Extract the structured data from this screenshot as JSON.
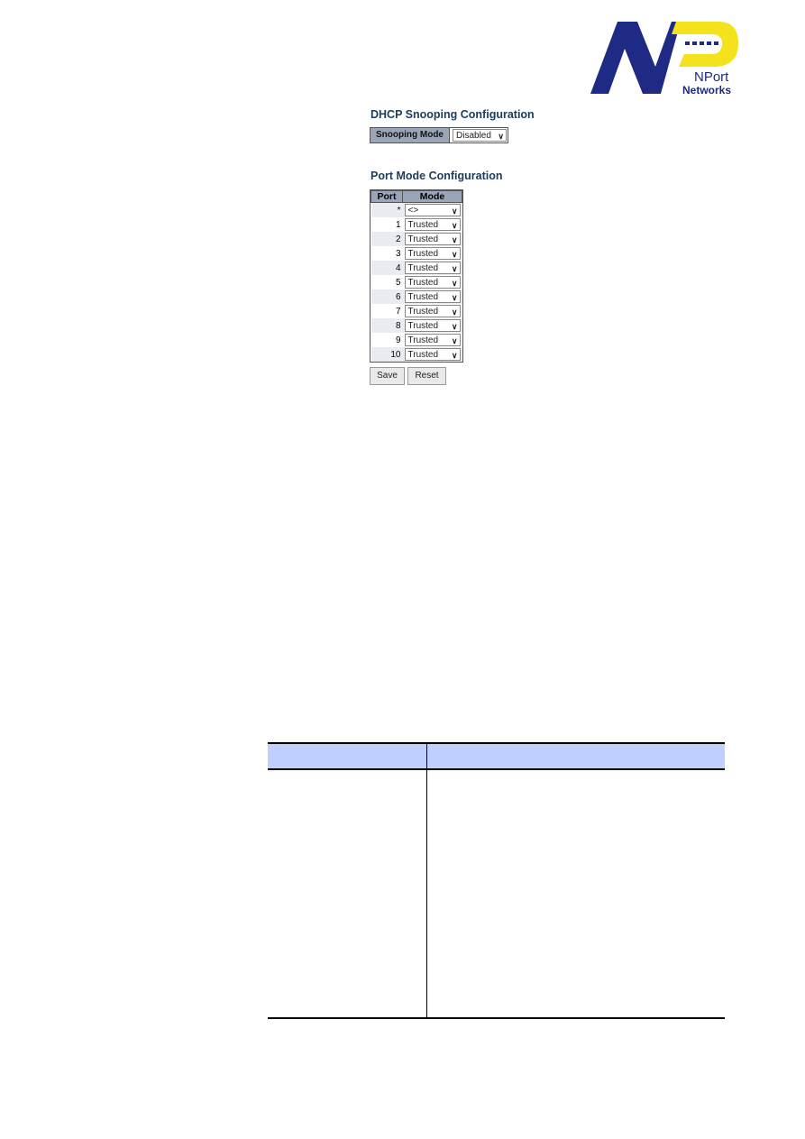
{
  "logo": {
    "brand_line1": "NPort",
    "brand_line2": "Networks",
    "colors": {
      "navy": "#1f2a85",
      "yellow": "#f4e21c"
    }
  },
  "dhcp": {
    "title": "DHCP Snooping Configuration",
    "mode_label": "Snooping Mode",
    "mode_value": "Disabled"
  },
  "port_mode": {
    "title": "Port Mode Configuration",
    "headers": [
      "Port",
      "Mode"
    ],
    "rows": [
      {
        "port": "*",
        "mode": "<>"
      },
      {
        "port": "1",
        "mode": "Trusted"
      },
      {
        "port": "2",
        "mode": "Trusted"
      },
      {
        "port": "3",
        "mode": "Trusted"
      },
      {
        "port": "4",
        "mode": "Trusted"
      },
      {
        "port": "5",
        "mode": "Trusted"
      },
      {
        "port": "6",
        "mode": "Trusted"
      },
      {
        "port": "7",
        "mode": "Trusted"
      },
      {
        "port": "8",
        "mode": "Trusted"
      },
      {
        "port": "9",
        "mode": "Trusted"
      },
      {
        "port": "10",
        "mode": "Trusted"
      }
    ]
  },
  "buttons": {
    "save": "Save",
    "reset": "Reset"
  },
  "desc_table": {
    "header_color": "#bfcfff"
  }
}
